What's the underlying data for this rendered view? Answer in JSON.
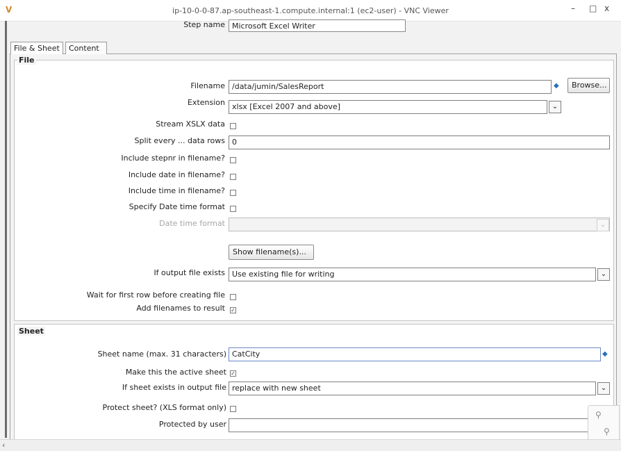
{
  "window": {
    "title": "ip-10-0-0-87.ap-southeast-1.compute.internal:1 (ec2-user) - VNC Viewer",
    "logo": "V",
    "controls": {
      "minimize": "–",
      "maximize": "□",
      "close": "x"
    }
  },
  "step": {
    "label": "Step name",
    "value": "Microsoft Excel Writer"
  },
  "tabs": [
    {
      "label": "File & Sheet",
      "active": true
    },
    {
      "label": "Content",
      "active": false
    }
  ],
  "file": {
    "group_title": "File",
    "filename": {
      "label": "Filename",
      "value": "/data/jumin/SalesReport",
      "browse": "Browse..."
    },
    "extension": {
      "label": "Extension",
      "value": "xlsx [Excel 2007 and above]"
    },
    "stream_xlsx": {
      "label": "Stream XSLX data",
      "checked": false
    },
    "split_every": {
      "label": "Split every ... data rows",
      "value": "0"
    },
    "include_stepnr": {
      "label": "Include stepnr in filename?",
      "checked": false
    },
    "include_date": {
      "label": "Include date in filename?",
      "checked": false
    },
    "include_time": {
      "label": "Include time in filename?",
      "checked": false
    },
    "specify_datetime": {
      "label": "Specify Date time format",
      "checked": false
    },
    "datetime_format": {
      "label": "Date time format",
      "value": "",
      "enabled": false
    },
    "show_filenames_button": "Show filename(s)...",
    "if_output_exists": {
      "label": "If output file exists",
      "value": "Use existing file for writing"
    },
    "wait_first_row": {
      "label": "Wait for first row before creating file",
      "checked": false
    },
    "add_filenames": {
      "label": "Add filenames to result",
      "checked": true
    }
  },
  "sheet": {
    "group_title": "Sheet",
    "sheet_name": {
      "label": "Sheet name (max. 31 characters)",
      "value": "CatCity"
    },
    "make_active": {
      "label": "Make this the active sheet",
      "checked": true
    },
    "if_sheet_exists": {
      "label": "If sheet exists in output file",
      "value": "replace with new sheet"
    },
    "protect_sheet": {
      "label": "Protect sheet? (XLS format only)",
      "checked": false
    },
    "protected_by": {
      "label": "Protected by user",
      "value": ""
    }
  },
  "icons": {
    "dropdown": "chevron-down-icon",
    "variable": "diamond-variable-icon",
    "check": "✓",
    "scroll_left": "‹",
    "zoom_in": "zoom-in-icon",
    "zoom_out": "zoom-out-icon"
  },
  "colors": {
    "focus": "#6a88c7",
    "variable_icon": "#2b6fb8"
  }
}
